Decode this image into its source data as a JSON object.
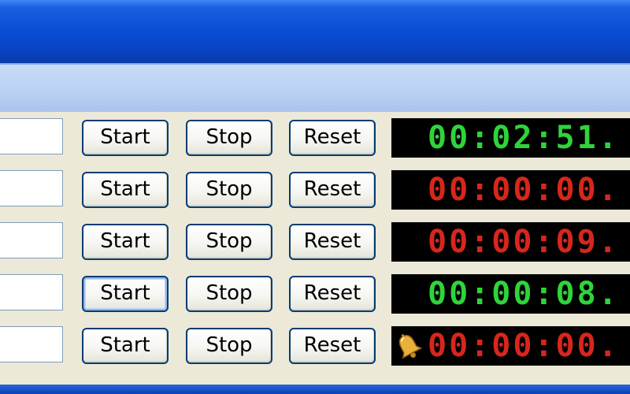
{
  "colors": {
    "running": "#2fd43a",
    "stopped": "#d8261c",
    "display_bg": "#000000",
    "titlebar": "#0a4fd8"
  },
  "buttons": {
    "start_label": "Start",
    "stop_label": "Stop",
    "reset_label": "Reset"
  },
  "timers": [
    {
      "name": "",
      "time": "00:02:51.",
      "state": "running",
      "alarm": false
    },
    {
      "name": "",
      "time": "00:00:00.",
      "state": "stopped",
      "alarm": false
    },
    {
      "name": "",
      "time": "00:00:09.",
      "state": "stopped",
      "alarm": false
    },
    {
      "name": "",
      "time": "00:00:08.",
      "state": "running",
      "alarm": false,
      "start_focused": true
    },
    {
      "name": "",
      "time": "00:00:00.",
      "state": "stopped",
      "alarm": true,
      "alarm_icon": "bell-icon"
    }
  ]
}
